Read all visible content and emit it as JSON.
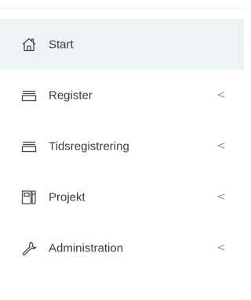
{
  "sidebar": {
    "items": [
      {
        "label": "Start",
        "icon": "home-icon",
        "active": true,
        "expandable": false
      },
      {
        "label": "Register",
        "icon": "tray-icon",
        "active": false,
        "expandable": true,
        "chevron": "<"
      },
      {
        "label": "Tidsregistrering",
        "icon": "tray-icon",
        "active": false,
        "expandable": true,
        "chevron": "<"
      },
      {
        "label": "Projekt",
        "icon": "notebook-icon",
        "active": false,
        "expandable": true,
        "chevron": "<"
      },
      {
        "label": "Administration",
        "icon": "wrench-icon",
        "active": false,
        "expandable": true,
        "chevron": "<"
      }
    ]
  },
  "colors": {
    "active_bg": "#eef3f6",
    "icon": "#4a4a4a",
    "text": "#3c3c3c",
    "chevron": "#9a9a9a"
  }
}
